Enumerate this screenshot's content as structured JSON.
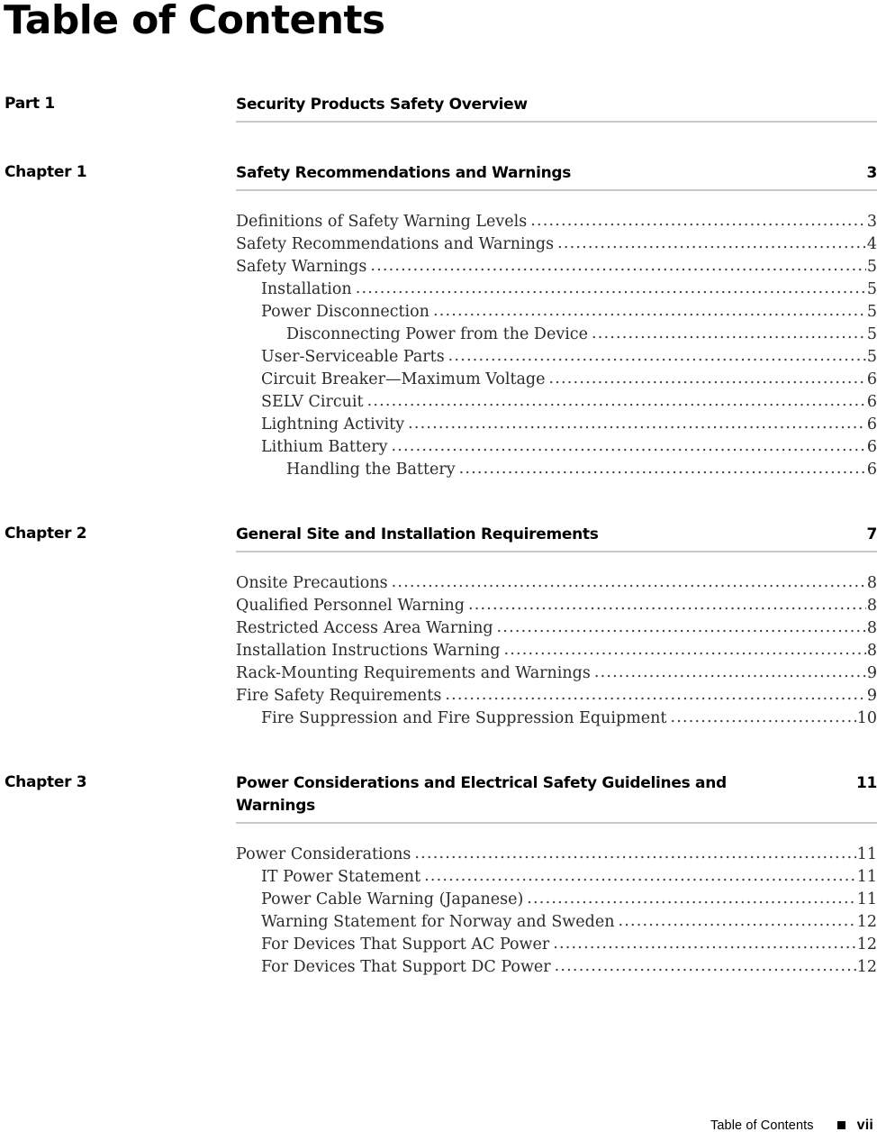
{
  "document": {
    "title": "Table of Contents"
  },
  "sections": [
    {
      "kind": "part",
      "label": "Part 1",
      "title": "Security Products Safety Overview",
      "page": "",
      "entries": []
    },
    {
      "kind": "chapter",
      "label": "Chapter 1",
      "title": "Safety Recommendations and Warnings",
      "page": "3",
      "entries": [
        {
          "level": 1,
          "text": "Definitions of Safety Warning Levels",
          "page": "3"
        },
        {
          "level": 1,
          "text": "Safety Recommendations and Warnings",
          "page": "4"
        },
        {
          "level": 1,
          "text": "Safety Warnings",
          "page": "5"
        },
        {
          "level": 2,
          "text": "Installation",
          "page": "5"
        },
        {
          "level": 2,
          "text": "Power Disconnection",
          "page": "5"
        },
        {
          "level": 3,
          "text": "Disconnecting Power from the Device",
          "page": "5"
        },
        {
          "level": 2,
          "text": "User-Serviceable Parts",
          "page": "5"
        },
        {
          "level": 2,
          "text": "Circuit Breaker—Maximum Voltage",
          "page": "6"
        },
        {
          "level": 2,
          "text": "SELV Circuit",
          "page": "6"
        },
        {
          "level": 2,
          "text": "Lightning Activity",
          "page": "6"
        },
        {
          "level": 2,
          "text": "Lithium Battery",
          "page": "6"
        },
        {
          "level": 3,
          "text": "Handling the Battery",
          "page": "6"
        }
      ]
    },
    {
      "kind": "chapter",
      "label": "Chapter 2",
      "title": "General Site and Installation Requirements",
      "page": "7",
      "entries": [
        {
          "level": 1,
          "text": "Onsite Precautions",
          "page": "8"
        },
        {
          "level": 1,
          "text": "Qualified Personnel Warning",
          "page": "8"
        },
        {
          "level": 1,
          "text": "Restricted Access Area Warning",
          "page": "8"
        },
        {
          "level": 1,
          "text": "Installation Instructions Warning",
          "page": "8"
        },
        {
          "level": 1,
          "text": "Rack-Mounting Requirements and Warnings",
          "page": "9"
        },
        {
          "level": 1,
          "text": "Fire Safety Requirements",
          "page": "9"
        },
        {
          "level": 2,
          "text": "Fire Suppression and Fire Suppression Equipment",
          "page": "10"
        }
      ]
    },
    {
      "kind": "chapter",
      "label": "Chapter 3",
      "title": "Power Considerations and Electrical Safety Guidelines and Warnings",
      "page": "11",
      "entries": [
        {
          "level": 1,
          "text": "Power Considerations",
          "page": "11"
        },
        {
          "level": 2,
          "text": "IT Power Statement",
          "page": "11"
        },
        {
          "level": 2,
          "text": "Power Cable Warning (Japanese)",
          "page": "11"
        },
        {
          "level": 2,
          "text": "Warning Statement for Norway and Sweden",
          "page": "12"
        },
        {
          "level": 2,
          "text": "For Devices That Support AC Power",
          "page": "12"
        },
        {
          "level": 2,
          "text": "For Devices That Support DC Power",
          "page": "12"
        }
      ]
    }
  ],
  "footer": {
    "text": "Table of Contents",
    "bullet_icon": "square-bullet-icon",
    "page": "vii"
  },
  "colors": {
    "rule": "#c9c9c9",
    "text": "#000000",
    "entry_text": "#2b2b2b"
  }
}
